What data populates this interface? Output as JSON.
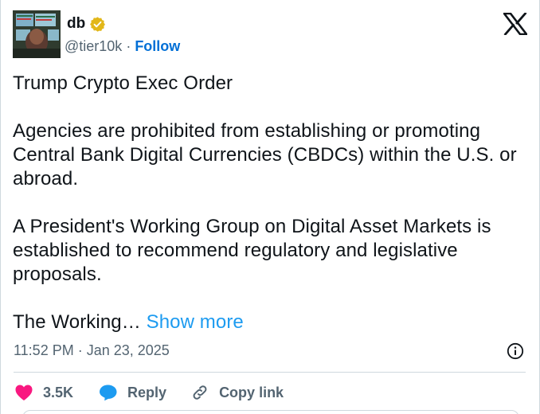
{
  "author": {
    "display_name": "db",
    "handle": "@tier10k",
    "separator": " · ",
    "follow_label": "Follow"
  },
  "tweet": {
    "paragraphs": [
      "Trump Crypto Exec Order",
      "Agencies are prohibited from establishing or promoting Central Bank Digital Currencies (CBDCs) within the U.S. or abroad.",
      "A President's Working Group on Digital Asset Markets is established to recommend regulatory and legislative proposals."
    ],
    "truncated_text": "The Working…",
    "show_more_label": "Show more"
  },
  "meta": {
    "timestamp": "11:52 PM · Jan 23, 2025"
  },
  "actions": {
    "like_count": "3.5K",
    "reply_label": "Reply",
    "copy_link_label": "Copy link"
  },
  "colors": {
    "like": "#f91880",
    "reply": "#1d9bf0",
    "link": "#1d9bf0",
    "follow": "#006fd6",
    "verified_badge": "#e2b719",
    "muted": "#536471"
  },
  "icons": {
    "platform": "x-logo-icon",
    "verified": "verified-badge-icon",
    "info": "info-icon",
    "like": "heart-icon",
    "reply": "speech-bubble-icon",
    "copy_link": "link-icon"
  }
}
